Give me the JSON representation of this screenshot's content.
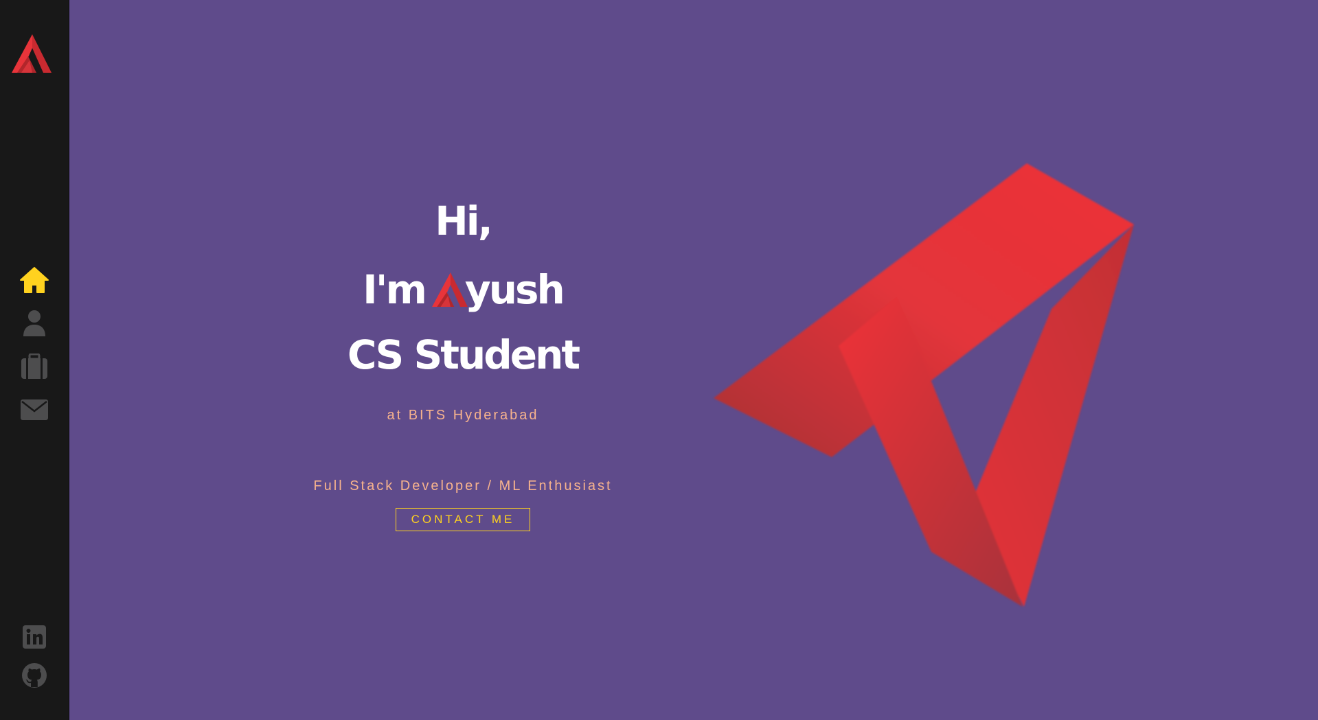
{
  "brand": {
    "logo_icon": "ayush-logo-icon",
    "accent": "#e8343a"
  },
  "nav": {
    "items": [
      {
        "id": "home",
        "icon": "home-icon",
        "active": true
      },
      {
        "id": "about",
        "icon": "user-icon",
        "active": false
      },
      {
        "id": "portfolio",
        "icon": "briefcase-icon",
        "active": false
      },
      {
        "id": "contact",
        "icon": "envelope-icon",
        "active": false
      }
    ],
    "active_color": "#ffd21f",
    "inactive_color": "#4d4d4e"
  },
  "social": [
    {
      "id": "linkedin",
      "icon": "linkedin-icon"
    },
    {
      "id": "github",
      "icon": "github-icon"
    }
  ],
  "hero": {
    "greeting": "Hi,",
    "intro_prefix": "I'm",
    "name_rest": "yush",
    "role": "CS Student",
    "subtitle": "at BITS Hyderabad",
    "tagline": "Full Stack Developer / ML Enthusiast",
    "cta_label": "CONTACT ME"
  },
  "colors": {
    "background": "#5f4b8b",
    "sidebar": "#181818",
    "heading": "#ffffff",
    "subtext": "#f7b38d",
    "cta": "#ffd21f"
  }
}
